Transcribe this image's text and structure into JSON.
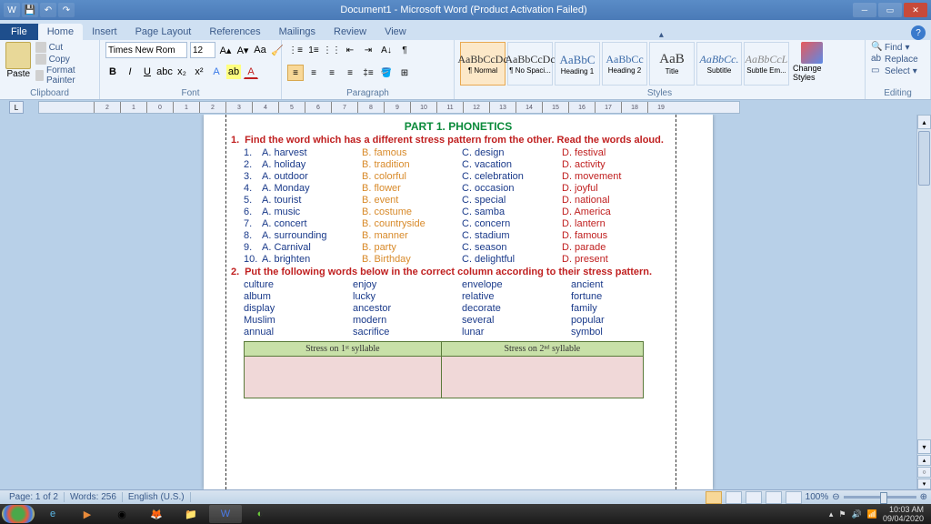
{
  "titlebar": {
    "title": "Document1 - Microsoft Word (Product Activation Failed)"
  },
  "tabs": {
    "file": "File",
    "items": [
      "Home",
      "Insert",
      "Page Layout",
      "References",
      "Mailings",
      "Review",
      "View"
    ],
    "active": 0
  },
  "ribbon": {
    "clipboard": {
      "label": "Clipboard",
      "paste": "Paste",
      "cut": "Cut",
      "copy": "Copy",
      "fp": "Format Painter"
    },
    "font": {
      "label": "Font",
      "name": "Times New Rom",
      "size": "12"
    },
    "paragraph": {
      "label": "Paragraph"
    },
    "styles": {
      "label": "Styles",
      "items": [
        {
          "prev": "AaBbCcDc",
          "name": "¶ Normal"
        },
        {
          "prev": "AaBbCcDc",
          "name": "¶ No Spaci..."
        },
        {
          "prev": "AaBbC",
          "name": "Heading 1"
        },
        {
          "prev": "AaBbCc",
          "name": "Heading 2"
        },
        {
          "prev": "AaB",
          "name": "Title"
        },
        {
          "prev": "AaBbCc.",
          "name": "Subtitle"
        },
        {
          "prev": "AaBbCcL",
          "name": "Subtle Em..."
        }
      ],
      "change": "Change Styles"
    },
    "editing": {
      "label": "Editing",
      "find": "Find",
      "replace": "Replace",
      "select": "Select"
    }
  },
  "doc": {
    "part": "PART 1. PHONETICS",
    "instr1_num": "1.",
    "instr1": "Find the word which has a different stress pattern from the other. Read the words aloud.",
    "q": [
      {
        "n": "1.",
        "a": "A. harvest",
        "b": "B. famous",
        "c": "C. design",
        "d": "D. festival"
      },
      {
        "n": "2.",
        "a": "A. holiday",
        "b": "B. tradition",
        "c": "C. vacation",
        "d": "D. activity"
      },
      {
        "n": "3.",
        "a": "A. outdoor",
        "b": "B. colorful",
        "c": "C. celebration",
        "d": "D. movement"
      },
      {
        "n": "4.",
        "a": "A. Monday",
        "b": "B. flower",
        "c": "C. occasion",
        "d": "D. joyful"
      },
      {
        "n": "5.",
        "a": "A. tourist",
        "b": "B. event",
        "c": "C. special",
        "d": "D. national"
      },
      {
        "n": "6.",
        "a": "A. music",
        "b": "B. costume",
        "c": "C. samba",
        "d": "D. America"
      },
      {
        "n": "7.",
        "a": "A. concert",
        "b": "B. countryside",
        "c": "C. concern",
        "d": "D. lantern"
      },
      {
        "n": "8.",
        "a": "A. surrounding",
        "b": "B. manner",
        "c": "C. stadium",
        "d": "D. famous"
      },
      {
        "n": "9.",
        "a": "A. Carnival",
        "b": "B. party",
        "c": "C. season",
        "d": "D. parade"
      },
      {
        "n": "10.",
        "a": "A. brighten",
        "b": "B. Birthday",
        "c": "C. delightful",
        "d": "D. present"
      }
    ],
    "instr2_num": "2.",
    "instr2": "Put the following words below in the correct column according to their stress pattern.",
    "words": [
      [
        "culture",
        "enjoy",
        "envelope",
        "ancient"
      ],
      [
        "album",
        "lucky",
        "relative",
        "fortune"
      ],
      [
        "display",
        "ancestor",
        "decorate",
        "family"
      ],
      [
        "Muslim",
        "modern",
        "several",
        "popular"
      ],
      [
        "annual",
        "sacrifice",
        "lunar",
        "symbol"
      ]
    ],
    "th1": "Stress on 1ˢᵗ syllable",
    "th2": "Stress on 2ⁿᵈ syllable"
  },
  "status": {
    "page": "Page: 1 of 2",
    "words": "Words: 256",
    "lang": "English (U.S.)",
    "zoom": "100%"
  },
  "tray": {
    "time": "10:03 AM",
    "date": "09/04/2020"
  }
}
